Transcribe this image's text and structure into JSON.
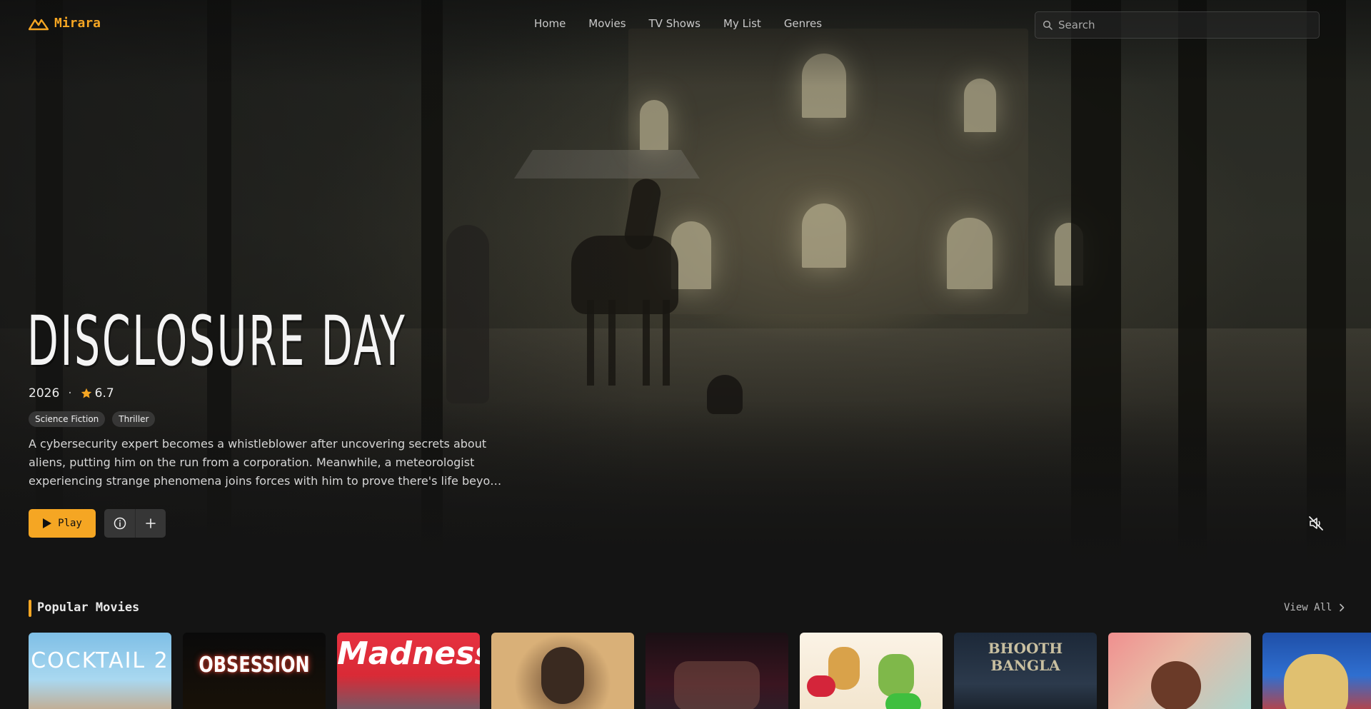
{
  "brand": {
    "name": "Mirara"
  },
  "nav": {
    "links": [
      "Home",
      "Movies",
      "TV Shows",
      "My List",
      "Genres"
    ]
  },
  "search": {
    "placeholder": "Search"
  },
  "hero": {
    "title": "DISCLOSURE DAY",
    "year": "2026",
    "separator": "·",
    "rating": "6.7",
    "genres": [
      "Science Fiction",
      "Thriller"
    ],
    "overview": "A cybersecurity expert becomes a whistleblower after uncovering secrets about aliens, putting him on the run from a corporation. Meanwhile, a meteorologist experiencing strange phenomena joins forces with him to prove there's life beyo…",
    "play_label": "Play"
  },
  "colors": {
    "accent": "#f5a623",
    "background": "#141414"
  },
  "icons": [
    "logo-icon",
    "search-icon",
    "star-icon",
    "play-icon",
    "info-icon",
    "plus-icon",
    "volume-mute-icon",
    "chevron-right-icon"
  ],
  "row": {
    "title": "Popular Movies",
    "view_all": "View All",
    "posters": [
      {
        "name": "poster-cocktail-2",
        "text": "COCKTAIL 2"
      },
      {
        "name": "poster-obsession",
        "text": "OBSESSION"
      },
      {
        "name": "poster-madness",
        "text": "Madness"
      },
      {
        "name": "poster-4",
        "text": ""
      },
      {
        "name": "poster-5",
        "text": ""
      },
      {
        "name": "poster-toy-story",
        "text": ""
      },
      {
        "name": "poster-bhooth-bangla",
        "text": "BHOOTH BANGLA"
      },
      {
        "name": "poster-8",
        "text": ""
      },
      {
        "name": "poster-9",
        "text": ""
      }
    ]
  }
}
